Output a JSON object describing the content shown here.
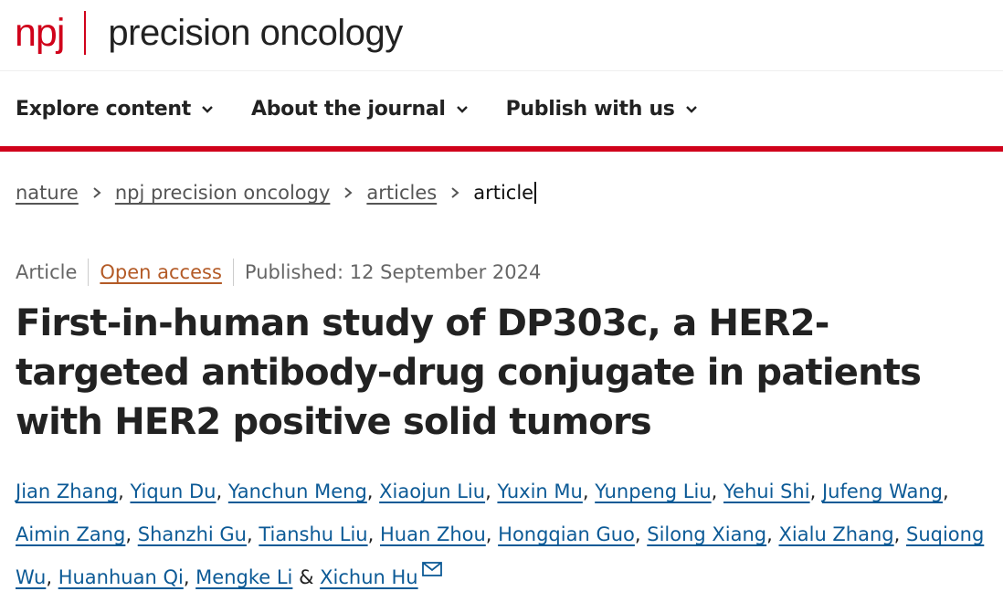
{
  "header": {
    "logo_prefix": "npj",
    "journal_name": "precision oncology"
  },
  "nav": {
    "items": [
      {
        "label": "Explore content"
      },
      {
        "label": "About the journal"
      },
      {
        "label": "Publish with us"
      }
    ]
  },
  "breadcrumb": {
    "items": [
      "nature",
      "npj precision oncology",
      "articles"
    ],
    "current": "article"
  },
  "meta": {
    "type": "Article",
    "access": "Open access",
    "published": "Published: 12 September 2024"
  },
  "article": {
    "title": "First-in-human study of DP303c, a HER2-targeted antibody-drug conjugate in patients with HER2 positive solid tumors"
  },
  "authors": {
    "list": [
      "Jian Zhang",
      "Yiqun Du",
      "Yanchun Meng",
      "Xiaojun Liu",
      "Yuxin Mu",
      "Yunpeng Liu",
      "Yehui Shi",
      "Jufeng Wang",
      "Aimin Zang",
      "Shanzhi Gu",
      "Tianshu Liu",
      "Huan Zhou",
      "Hongqian Guo",
      "Silong Xiang",
      "Xialu Zhang",
      "Suqiong Wu",
      "Huanhuan Qi",
      "Mengke Li",
      "Xichun Hu"
    ],
    "separator": ", ",
    "conjunction": " & "
  },
  "colors": {
    "brand_red": "#d0021b",
    "link_blue": "#0c5a96",
    "open_access_orange": "#b35a26"
  },
  "icons": {
    "nav_dropdown": "chevron-down-icon",
    "breadcrumb_separator": "chevron-right-icon",
    "corresponding_author": "mail-icon"
  }
}
